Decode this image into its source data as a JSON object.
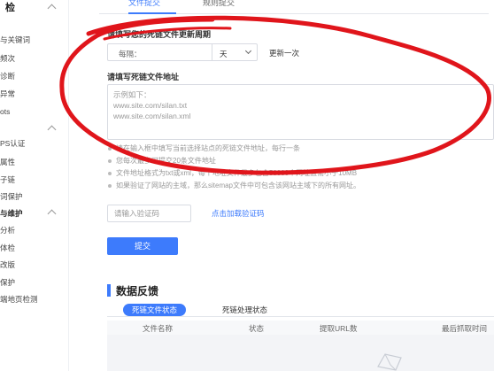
{
  "sidebar": {
    "items": [
      {
        "label": "检",
        "head": true
      },
      {
        "label": "与关键词"
      },
      {
        "label": "频次"
      },
      {
        "label": "诊断"
      },
      {
        "label": "异常"
      },
      {
        "label": "ots"
      },
      {
        "label": "PS认证"
      },
      {
        "label": "属性"
      },
      {
        "label": "子链"
      },
      {
        "label": "词保护"
      },
      {
        "label": "与维护",
        "head": true
      },
      {
        "label": "分析"
      },
      {
        "label": "体检"
      },
      {
        "label": "改版"
      },
      {
        "label": "保护"
      },
      {
        "label": "端地页检测"
      }
    ]
  },
  "tabs": [
    {
      "label": "文件提交",
      "active": true
    },
    {
      "label": "规则提交",
      "active": false
    }
  ],
  "frequency": {
    "label": "请填写您的死链文件更新周期",
    "prefix": "每隔：",
    "unit": "天",
    "suffix": "更新一次"
  },
  "file_address": {
    "label": "请填写死链文件地址",
    "placeholder_lines": [
      "示例如下：",
      "www.site.com/silan.txt",
      "www.site.com/silan.xml"
    ]
  },
  "tips": [
    "请在输入框中填写当前选择站点的死链文件地址，每行一条",
    "您每次最多可提交20条文件地址",
    "文件地址格式为txt或xml，每个地址文件最多包含50000个网址且需小于10MB",
    "如果验证了网站的主域，那么sitemap文件中可包含该网站主域下的所有网址。"
  ],
  "captcha": {
    "placeholder": "请输入验证码",
    "link": "点击加载验证码"
  },
  "submit_label": "提交",
  "feedback": {
    "title": "数据反馈",
    "tabs": [
      {
        "label": "死链文件状态",
        "active": true
      },
      {
        "label": "死链处理状态",
        "active": false
      }
    ],
    "columns": [
      "文件名称",
      "状态",
      "提取URL数",
      "最后抓取时间"
    ]
  },
  "colors": {
    "accent": "#3d7bfc",
    "annotation": "#e0151b"
  }
}
